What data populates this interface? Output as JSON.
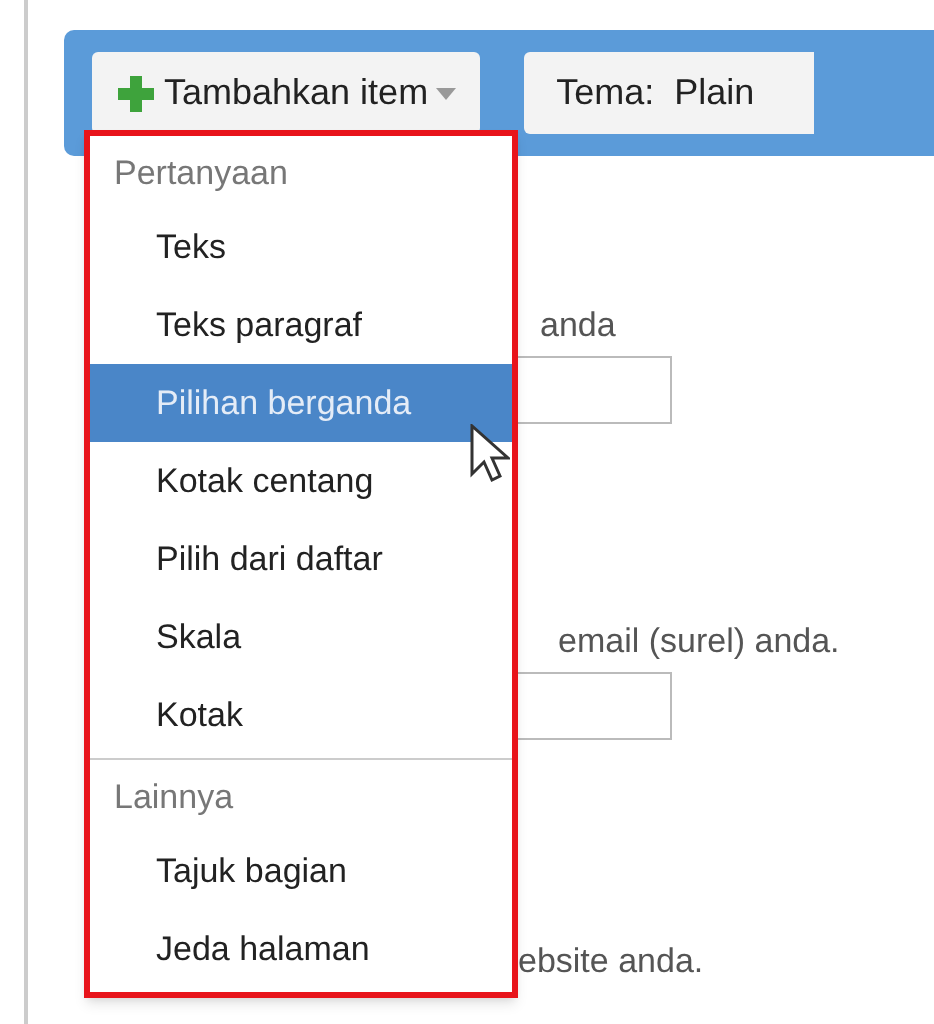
{
  "toolbar": {
    "add_button": {
      "label": "Tambahkan item",
      "expanded": true
    },
    "theme_button": {
      "label": "Tema:  Plain"
    }
  },
  "form": [
    {
      "text": "anda",
      "kind": "field"
    },
    {
      "text": "email (surel) anda.",
      "kind": "field"
    },
    {
      "text": "ebsite anda.",
      "kind": "text"
    }
  ],
  "menu": {
    "sections": [
      {
        "header": "Pertanyaan",
        "items": [
          {
            "label": "Teks",
            "selected": false
          },
          {
            "label": "Teks paragraf",
            "selected": false
          },
          {
            "label": "Pilihan berganda",
            "selected": true
          },
          {
            "label": "Kotak centang",
            "selected": false
          },
          {
            "label": "Pilih dari daftar",
            "selected": false
          },
          {
            "label": "Skala",
            "selected": false
          },
          {
            "label": "Kotak",
            "selected": false
          }
        ]
      },
      {
        "header": "Lainnya",
        "items": [
          {
            "label": "Tajuk bagian",
            "selected": false
          },
          {
            "label": "Jeda halaman",
            "selected": false
          }
        ]
      }
    ]
  }
}
